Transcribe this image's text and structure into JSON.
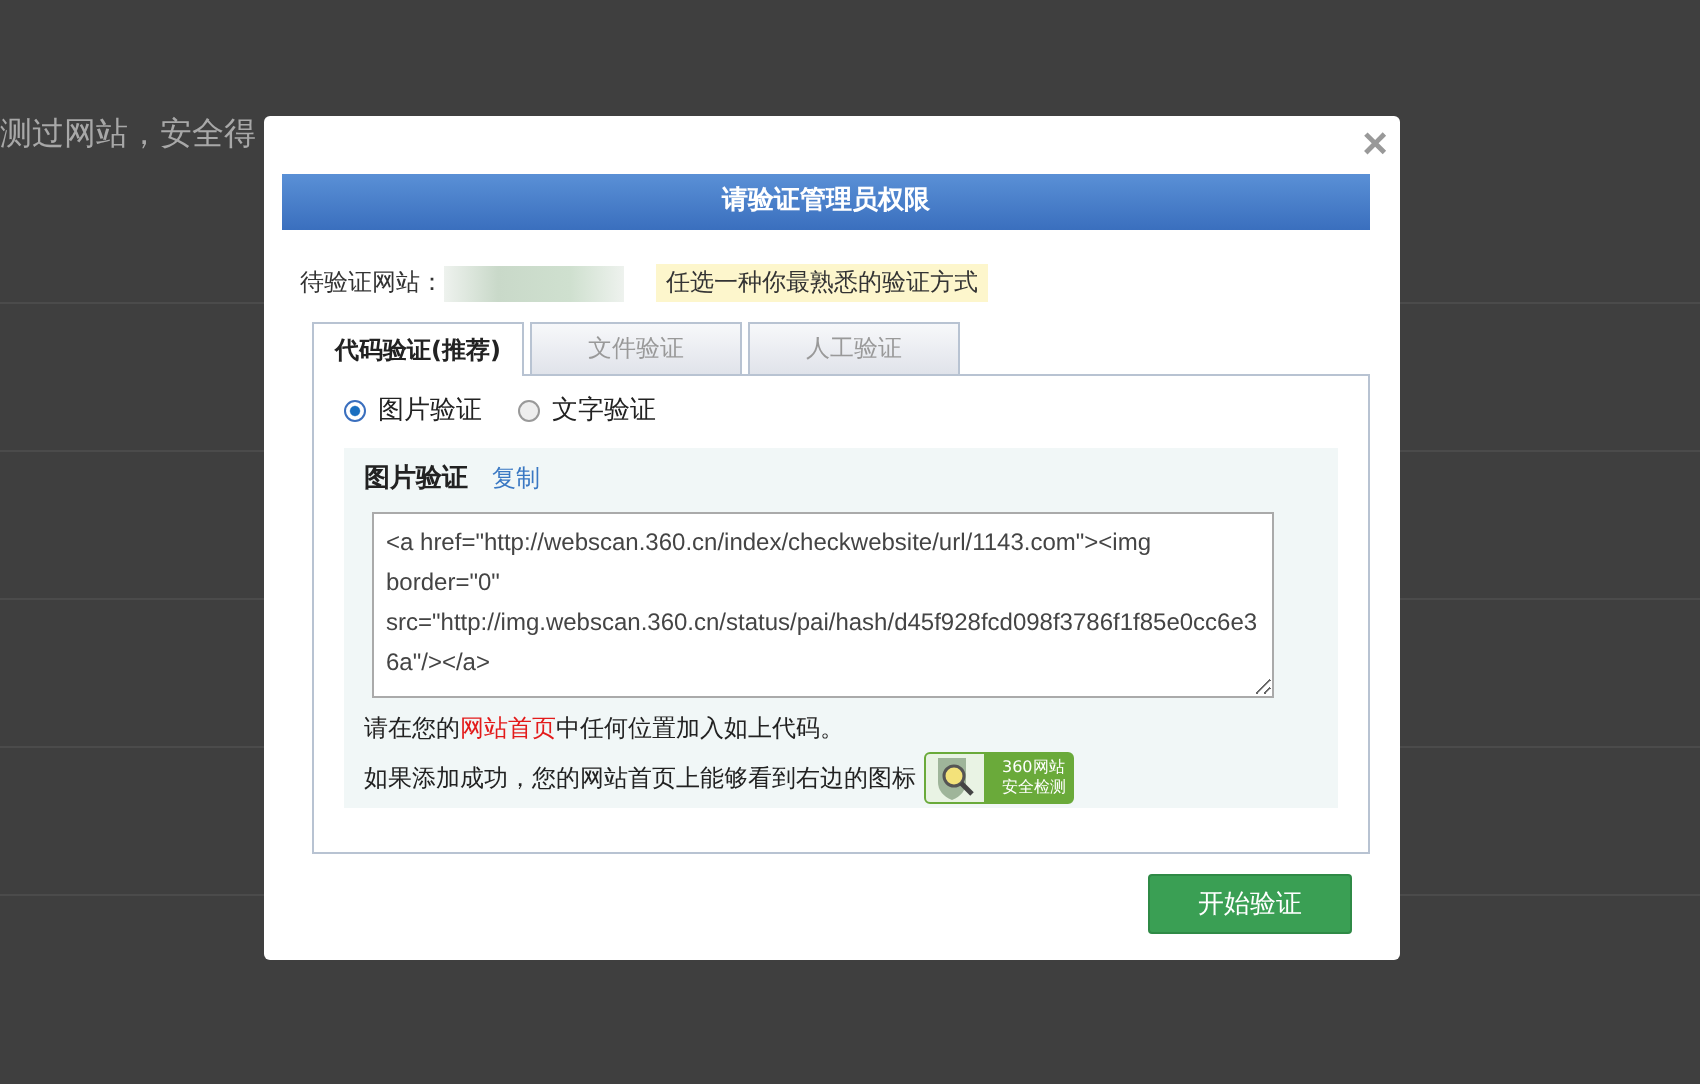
{
  "background": {
    "text": "测过网站，安全得"
  },
  "dialog": {
    "title": "请验证管理员权限",
    "close": "×",
    "site_label": "待验证网站：",
    "hint": "任选一种你最熟悉的验证方式",
    "tabs": [
      {
        "label": "代码验证(推荐)",
        "selected": true
      },
      {
        "label": "文件验证",
        "selected": false
      },
      {
        "label": "人工验证",
        "selected": false
      }
    ],
    "options": [
      {
        "label": "图片验证",
        "selected": true
      },
      {
        "label": "文字验证",
        "selected": false
      }
    ],
    "section_title": "图片验证",
    "copy_link": "复制",
    "code": "<a href=\"http://webscan.360.cn/index/checkwebsite/url/1143.com\"><img border=\"0\" src=\"http://img.webscan.360.cn/status/pai/hash/d45f928fcd098f3786f1f85e0cc6e36a\"/></a>",
    "instruction": [
      {
        "text": "请在您的",
        "highlight": false
      },
      {
        "text": "网站首页",
        "highlight": true
      },
      {
        "text": "中任何位置加入如上代码。",
        "highlight": false
      }
    ],
    "result_text": "如果添加成功，您的网站首页上能够看到右边的图标",
    "badge": [
      "360网站",
      "安全检测"
    ],
    "submit": "开始验证"
  }
}
